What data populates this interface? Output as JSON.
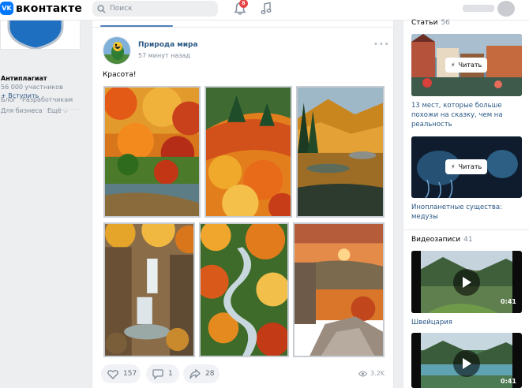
{
  "header": {
    "logo_text": "вконтакте",
    "logo_badge": "VK",
    "search_placeholder": "Поиск",
    "notifications_count": "8"
  },
  "left": {
    "group_name": "Антиплагиат",
    "group_members": "56 000 участников",
    "join_label": "+ Вступить",
    "footer_links": [
      "Блог",
      "Разработчикам",
      "Для бизнеса",
      "Ещё ⌵"
    ]
  },
  "post": {
    "author": "Природа мира",
    "time": "57 минут назад",
    "more": "•••",
    "text": "Красота!",
    "likes": "157",
    "comments": "1",
    "shares": "28",
    "views": "3.2K",
    "photos": [
      "autumn-river-forest",
      "autumn-forest-hills",
      "lake-reflection-mountains",
      "waterfall-autumn",
      "winding-river-autumn",
      "sunset-rock-valley"
    ]
  },
  "right": {
    "articles_title": "Статьи",
    "articles_count": "56",
    "read_label": "Читать",
    "articles": [
      {
        "caption": "13 мест, которые больше похожи на сказку, чем на реальность"
      },
      {
        "caption": "Инопланетные существа: медузы"
      }
    ],
    "videos_title": "Видеозаписи",
    "videos_count": "41",
    "videos": [
      {
        "caption": "Швейцария",
        "duration": "0:41"
      },
      {
        "caption": "",
        "duration": "0:41"
      }
    ]
  },
  "colors": {
    "brand": "#0077ff",
    "link": "#2a5885",
    "badge": "#e64646"
  }
}
